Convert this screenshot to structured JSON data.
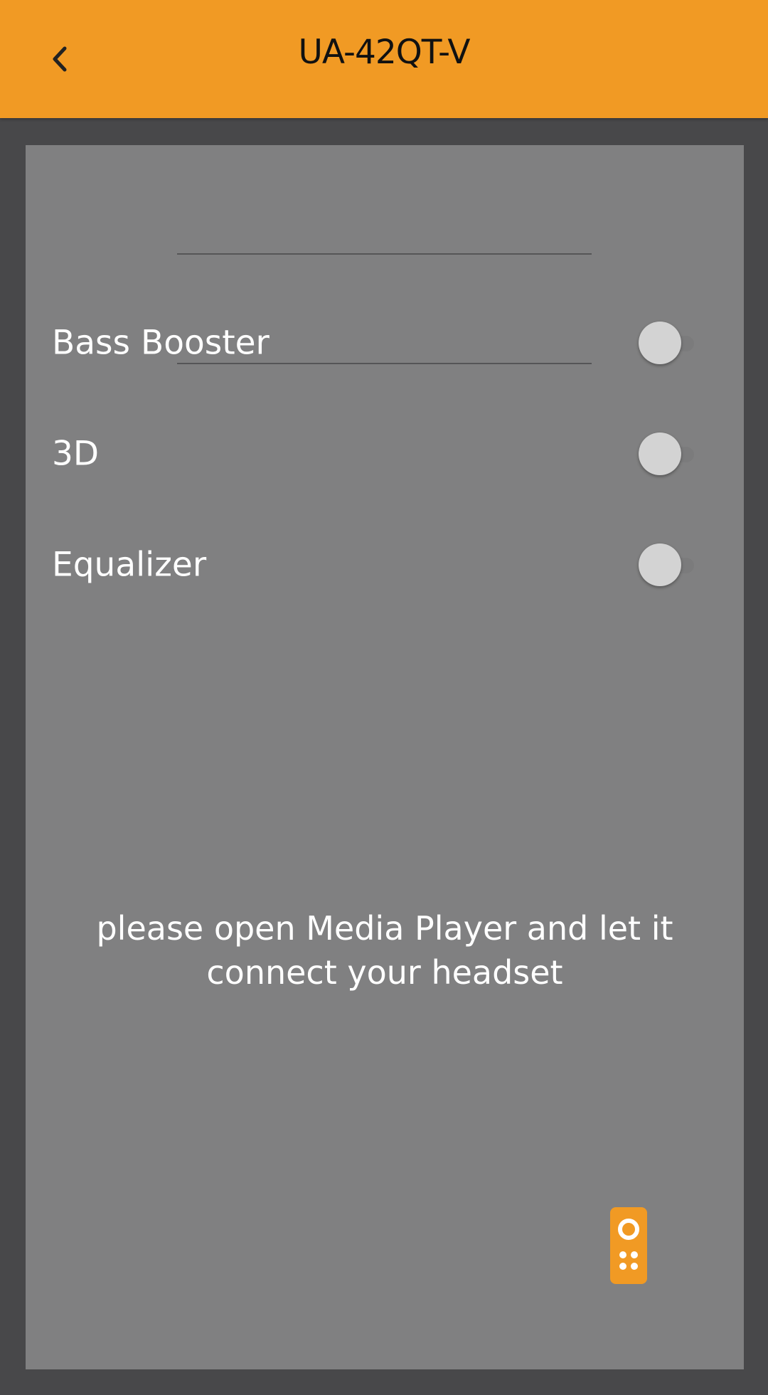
{
  "app_bar": {
    "title": "UA-42QT-V",
    "back_icon": "chevron-left-icon",
    "color": "#f19a24"
  },
  "settings": [
    {
      "label": "Bass Booster",
      "enabled": false
    },
    {
      "label": "3D",
      "enabled": false
    },
    {
      "label": "Equalizer",
      "enabled": false
    }
  ],
  "message": {
    "line1": "please open Media Player and let it",
    "line2": "connect your headset"
  },
  "floating_button": {
    "icon": "remote-control-icon",
    "color": "#f19a24"
  }
}
